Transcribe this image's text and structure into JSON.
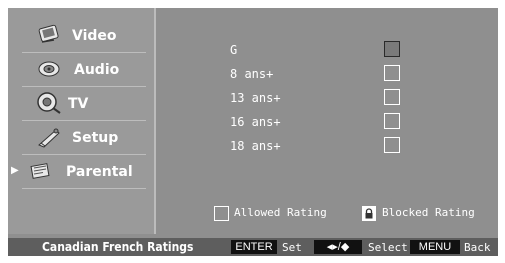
{
  "menu": {
    "items": [
      {
        "label": "Video",
        "icon": "video-icon",
        "selected": false
      },
      {
        "label": "Audio",
        "icon": "audio-icon",
        "selected": false
      },
      {
        "label": "TV",
        "icon": "tv-icon",
        "selected": false
      },
      {
        "label": "Setup",
        "icon": "setup-icon",
        "selected": false
      },
      {
        "label": "Parental",
        "icon": "parental-icon",
        "selected": true
      }
    ],
    "selected_arrow": "▶"
  },
  "ratings": [
    {
      "label": "G",
      "blocked": true
    },
    {
      "label": "8 ans+",
      "blocked": false
    },
    {
      "label": "13 ans+",
      "blocked": false
    },
    {
      "label": "16 ans+",
      "blocked": false
    },
    {
      "label": "18 ans+",
      "blocked": false
    }
  ],
  "legend": {
    "allowed": "Allowed Rating",
    "blocked": "Blocked Rating"
  },
  "footer": {
    "title": "Canadian French Ratings",
    "enter_key": "ENTER",
    "enter_hint": "Set",
    "nav_key": "◂▸/◆",
    "nav_hint": "Select",
    "menu_key": "MENU",
    "menu_hint": "Back"
  },
  "colors": {
    "panel": "#8f8f8f",
    "sidebar": "#9a9a9a",
    "footer": "#5e5e5e",
    "key": "#111111",
    "text": "#ffffff"
  }
}
